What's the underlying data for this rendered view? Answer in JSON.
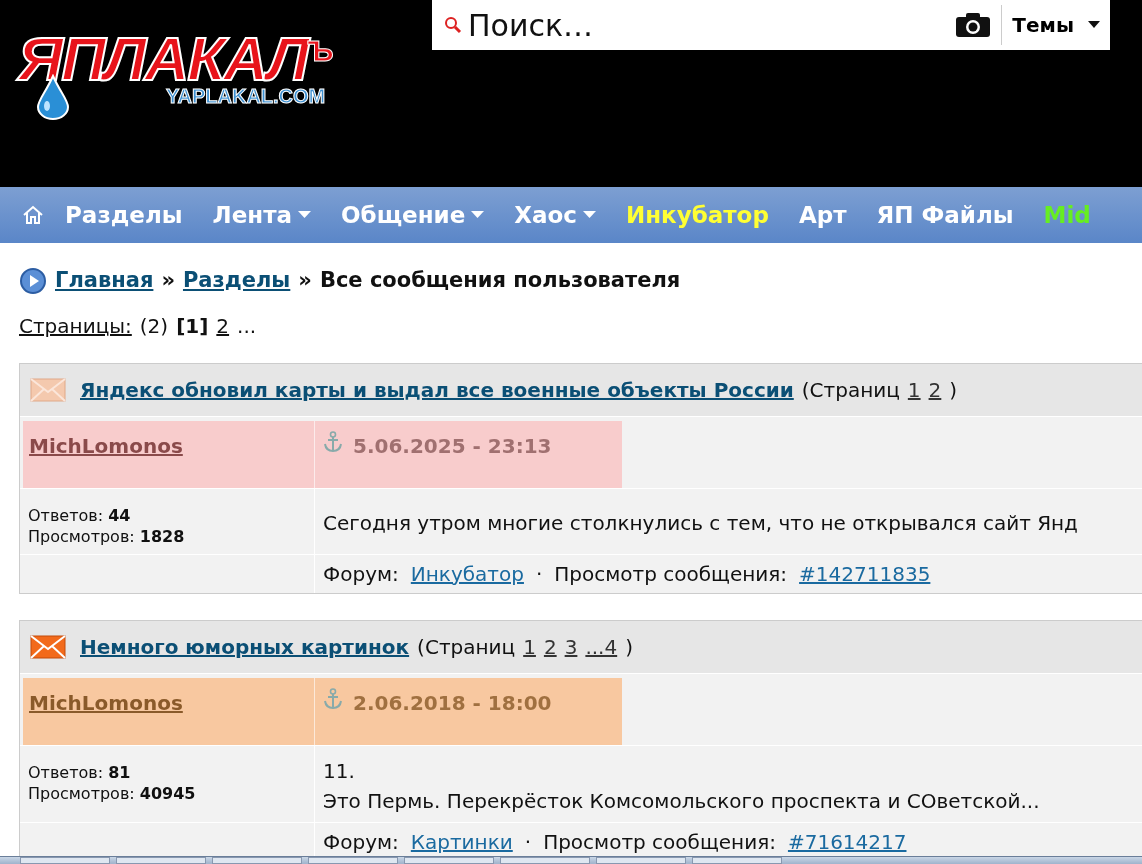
{
  "logo": {
    "title": "ЯПЛАКАЛ",
    "suffix": "Ъ",
    "subtitle": "YAPLAKAL.COM"
  },
  "search": {
    "placeholder": "Поиск…",
    "scope": "Темы"
  },
  "nav": [
    {
      "label": "Разделы",
      "color": "#ffffff",
      "dropdown": false
    },
    {
      "label": "Лента",
      "color": "#ffffff",
      "dropdown": true
    },
    {
      "label": "Общение",
      "color": "#ffffff",
      "dropdown": true
    },
    {
      "label": "Хаос",
      "color": "#ffffff",
      "dropdown": true
    },
    {
      "label": "Инкубатор",
      "color": "#ffff33",
      "dropdown": false
    },
    {
      "label": "Арт",
      "color": "#ffffff",
      "dropdown": false
    },
    {
      "label": "ЯП Файлы",
      "color": "#ffffff",
      "dropdown": false
    },
    {
      "label": "Mid",
      "color": "#66ee22",
      "dropdown": false
    }
  ],
  "breadcrumb": {
    "links": [
      "Главная",
      "Разделы"
    ],
    "separator": "»",
    "current": "Все сообщения пользователя"
  },
  "pages": {
    "label": "Страницы:",
    "count": "(2)",
    "items": [
      {
        "label": "[1]",
        "selected": true
      },
      {
        "label": "2",
        "selected": false
      },
      {
        "label": "...",
        "selected": false
      }
    ]
  },
  "posts": [
    {
      "unread": false,
      "title": "Яндекс обновил карты и выдал все военные объекты России",
      "pages_label": "(Страниц",
      "pages": [
        "1",
        "2"
      ],
      "pages_end": ")",
      "author": "MichLomonos",
      "date": "5.06.2025 - 23:13",
      "color": "#f8cccc",
      "replies_label": "Ответов:",
      "replies": "44",
      "views_label": "Просмотров:",
      "views": "1828",
      "lines": [
        "Сегодня утром многие столкнулись с тем, что не открывался сайт Янд"
      ],
      "forum_label": "Форум:",
      "forum": "Инкубатор",
      "dot": "·",
      "view_label": "Просмотр сообщения:",
      "post_link": "#142711835"
    },
    {
      "unread": true,
      "title": "Немного юморных картинок",
      "pages_label": "(Страниц",
      "pages": [
        "1",
        "2",
        "3",
        "...4"
      ],
      "pages_end": ")",
      "author": "MichLomonos",
      "date": "2.06.2018 - 18:00",
      "color": "#f8c8a0",
      "replies_label": "Ответов:",
      "replies": "81",
      "views_label": "Просмотров:",
      "views": "40945",
      "lines": [
        "11.",
        "Это Пермь. Перекрёсток Комсомольского проспекта и СОветской..."
      ],
      "forum_label": "Форум:",
      "forum": "Картинки",
      "dot": "·",
      "view_label": "Просмотр сообщения:",
      "post_link": "#71614217"
    }
  ]
}
